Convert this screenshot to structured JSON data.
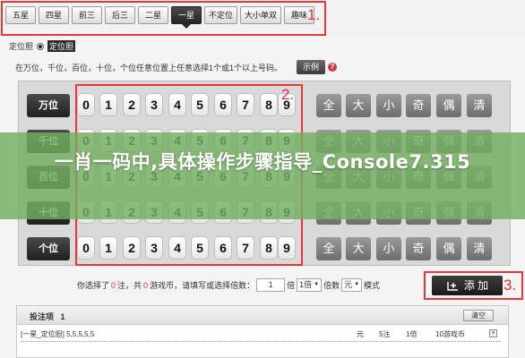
{
  "tabs": [
    "五星",
    "四星",
    "前三",
    "后三",
    "二星",
    "一星",
    "不定位",
    "大小单双",
    "趣味"
  ],
  "active_tab_index": 5,
  "annotations": {
    "one": "1.",
    "two": "2.",
    "three": "3."
  },
  "mode": {
    "label": "定位胆",
    "option": "定位胆"
  },
  "instruction": "在万位，千位，百位，十位，个位任意位置上任意选择1个或1个以上号码。",
  "example_button": "示例",
  "help_icon": "?",
  "positions": [
    "万位",
    "千位",
    "百位",
    "十位",
    "个位"
  ],
  "digits": [
    "0",
    "1",
    "2",
    "3",
    "4",
    "5",
    "6",
    "7",
    "8",
    "9"
  ],
  "quick_select": [
    "全",
    "大",
    "小",
    "奇",
    "偶",
    "清"
  ],
  "banner": "一肖一码中,具体操作步骤指导_Console7.315",
  "bet_summary": {
    "prefix": "你选择了",
    "bets_count": "0",
    "bets_unit": "注，共",
    "coins_count": "0",
    "coins_unit": "游戏币，请填写或选择倍数：",
    "multiplier_value": "1",
    "times_label": "倍",
    "multiplier_select": "1倍",
    "multiple_label": "倍数",
    "currency_select": "元",
    "mode_label": "模式"
  },
  "add_button": "添 加",
  "betting": {
    "title": "投注项",
    "count": "1",
    "clear_button": "清空",
    "items": [
      {
        "desc": "[一星_定位胆] 5,5,5,5,5",
        "unit": "元",
        "bets": "5注",
        "multiple": "1倍",
        "amount": "10游戏币",
        "remove": "×"
      }
    ]
  },
  "colors": {
    "accent_red": "#e23a3a",
    "banner_green": "#73af5f",
    "dark_button": "#262626"
  }
}
